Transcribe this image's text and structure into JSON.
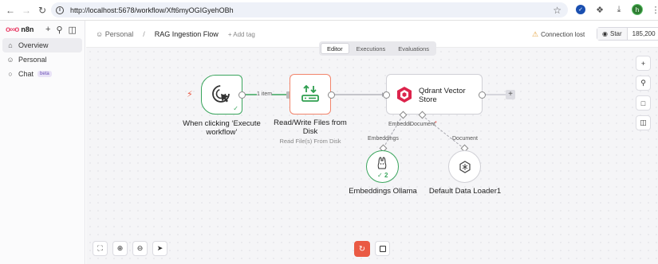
{
  "browser": {
    "url": "http://localhost:5678/workflow/Xft6myOGIGyehOBh",
    "avatar_letter": "h"
  },
  "sidebar": {
    "brand": "n8n",
    "items": [
      {
        "label": "Overview",
        "icon": "home-icon"
      },
      {
        "label": "Personal",
        "icon": "user-icon"
      },
      {
        "label": "Chat",
        "icon": "chat-icon",
        "badge": "beta"
      }
    ]
  },
  "header": {
    "owner": "Personal",
    "separator": "/",
    "title": "RAG Ingestion Flow",
    "add_tag": "+ Add tag",
    "connection_status": "Connection lost",
    "github_star": "Star",
    "github_count": "185,200"
  },
  "tabs": [
    "Editor",
    "Executions",
    "Evaluations"
  ],
  "nodes": {
    "trigger": {
      "label": "When clicking ‘Execute workflow’"
    },
    "readwrite": {
      "label": "Read/Write Files from Disk",
      "subtitle": "Read File(s) From Disk"
    },
    "qdrant": {
      "label": "Qdrant Vector Store",
      "port_embeddings": "Embeddi",
      "port_document": "Document",
      "required_mark": "*"
    },
    "embeddings": {
      "label": "Embeddings Ollama",
      "port_label": "Embeddings",
      "run_count": "2"
    },
    "loader": {
      "label": "Default Data Loader1",
      "port_label": "Document"
    }
  },
  "connection_label": "1 item",
  "colors": {
    "accent": "#ea4b71",
    "success": "#3aa55d",
    "execute": "#ea5a44"
  }
}
